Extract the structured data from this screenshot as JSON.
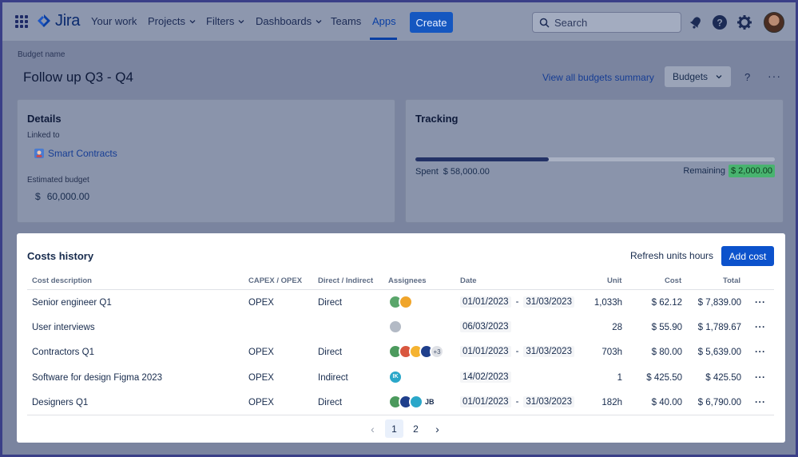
{
  "nav": {
    "logo": "Jira",
    "items": [
      {
        "label": "Your work",
        "dropdown": false
      },
      {
        "label": "Projects",
        "dropdown": true
      },
      {
        "label": "Filters",
        "dropdown": true
      },
      {
        "label": "Dashboards",
        "dropdown": true
      },
      {
        "label": "Teams",
        "dropdown": false
      },
      {
        "label": "Apps",
        "dropdown": false,
        "active": true
      }
    ],
    "create_label": "Create",
    "search_placeholder": "Search",
    "icons": [
      "app-switcher-icon",
      "notifications-icon",
      "help-icon",
      "settings-icon",
      "avatar"
    ]
  },
  "header": {
    "breadcrumb": "Budget name",
    "title": "Follow up Q3 - Q4",
    "view_link": "View all budgets summary",
    "budgets_button": "Budgets",
    "help": "?",
    "more": "···"
  },
  "details": {
    "title": "Details",
    "linked_label": "Linked to",
    "linked_value": "Smart Contracts",
    "estimated_label": "Estimated budget",
    "currency": "$",
    "estimated_value": "60,000.00"
  },
  "tracking": {
    "title": "Tracking",
    "spent_label": "Spent",
    "spent_value": "$ 58,000.00",
    "remaining_label": "Remaining",
    "remaining_value": "$ 2,000.00",
    "progress_fraction": 0.37
  },
  "costs": {
    "title": "Costs history",
    "refresh_label": "Refresh units hours",
    "add_label": "Add cost",
    "columns": [
      "Cost description",
      "CAPEX / OPEX",
      "Direct / Indirect",
      "Assignees",
      "Date",
      "Unit",
      "Cost",
      "Total"
    ],
    "rows": [
      {
        "description": "Senior engineer Q1",
        "capex": "OPEX",
        "direct": "Direct",
        "date_from": "01/01/2023",
        "date_sep": "-",
        "date_to": "31/03/2023",
        "unit": "1,033h",
        "cost": "$ 62.12",
        "total": "$ 7,839.00",
        "assignees": [
          "#5aa66b",
          "#f0a52b"
        ],
        "assignee_text": ""
      },
      {
        "description": "User interviews",
        "capex": "",
        "direct": "",
        "date_from": "06/03/2023",
        "date_sep": "",
        "date_to": "",
        "unit": "28",
        "cost": "$ 55.90",
        "total": "$ 1,789.67",
        "assignees": [
          "#b3bac5"
        ],
        "assignee_text": ""
      },
      {
        "description": "Contractors Q1",
        "capex": "OPEX",
        "direct": "Direct",
        "date_from": "01/01/2023",
        "date_sep": "-",
        "date_to": "31/03/2023",
        "unit": "703h",
        "cost": "$ 80.00",
        "total": "$ 5,639.00",
        "assignees": [
          "#4c9a5d",
          "#d9573f",
          "#f5b331",
          "#1f3f8c"
        ],
        "assignee_text": "+3"
      },
      {
        "description": "Software for design Figma 2023",
        "capex": "OPEX",
        "direct": "Indirect",
        "date_from": "14/02/2023",
        "date_sep": "",
        "date_to": "",
        "unit": "1",
        "cost": "$ 425.50",
        "total": "$ 425.50",
        "assignees": [
          "#2aa7c9"
        ],
        "assignee_text": "IK"
      },
      {
        "description": "Designers Q1",
        "capex": "OPEX",
        "direct": "Direct",
        "date_from": "01/01/2023",
        "date_sep": "-",
        "date_to": "31/03/2023",
        "unit": "182h",
        "cost": "$ 40.00",
        "total": "$ 6,790.00",
        "assignees": [
          "#4c9a5d",
          "#1f3f8c",
          "#2aa7c9"
        ],
        "assignee_text": "JB"
      }
    ],
    "row_more": "···",
    "pagination": {
      "pages": [
        "1",
        "2"
      ],
      "current": "1",
      "prev": "‹",
      "next": "›"
    }
  }
}
